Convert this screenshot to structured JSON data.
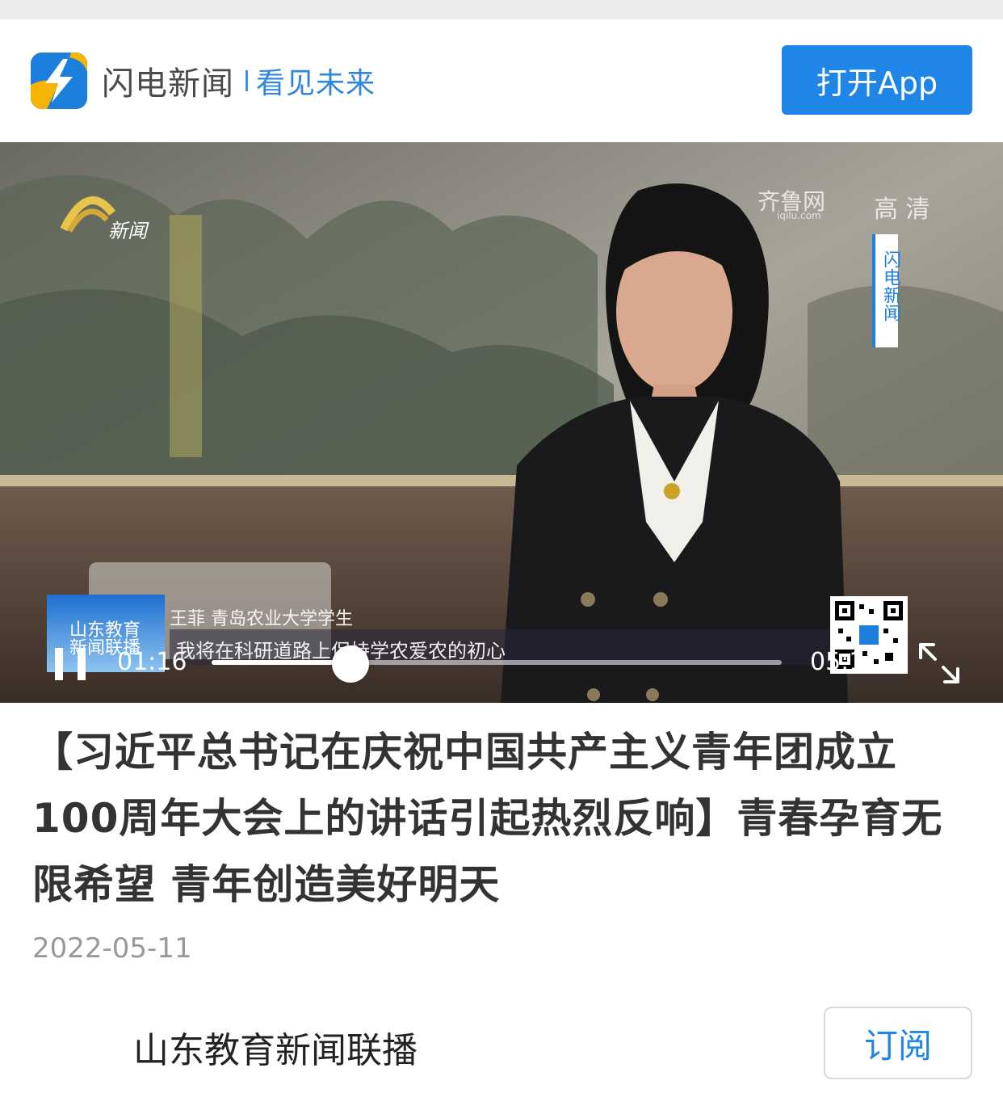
{
  "header": {
    "brand_name": "闪电新闻",
    "slogan": "看见未来",
    "open_app_label": "打开App",
    "accent_color": "#1f86e8"
  },
  "video": {
    "overlays": {
      "top_left_logo_text": "新闻",
      "top_right_watermark": "齐鲁网",
      "watermark_url": "iqilu.com",
      "quality_label": "高 清",
      "vertical_brand": "闪电新闻"
    },
    "caption": {
      "badge_text": "山东教育新闻联播",
      "speaker": "王菲   青岛农业大学学生",
      "quote": "我将在科研道路上保持学农爱农的初心"
    },
    "current_time": "01:16",
    "total_time": "05:11",
    "progress": 0.244
  },
  "article": {
    "title": "【习近平总书记在庆祝中国共产主义青年团成立100周年大会上的讲话引起热烈反响】青春孕育无限希望 青年创造美好明天",
    "date": "2022-05-11"
  },
  "channel": {
    "name": "山东教育新闻联播",
    "subscribe_label": "订阅"
  }
}
